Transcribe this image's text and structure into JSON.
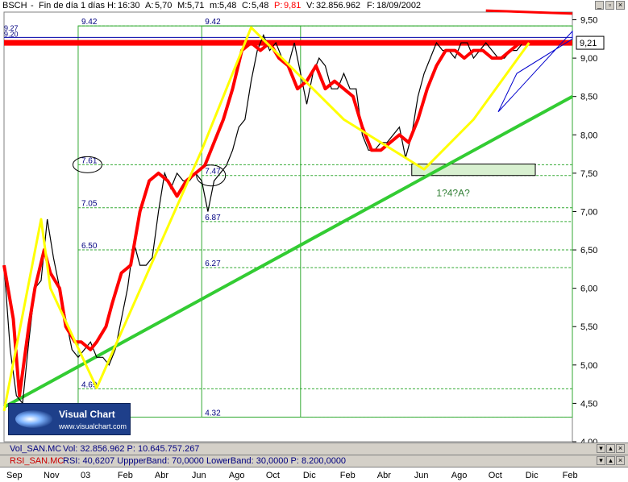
{
  "header": {
    "symbol": "BSCH",
    "period": "Fin de día 1 días",
    "items": [
      {
        "label": "H:",
        "value": "16:30"
      },
      {
        "label": "A:",
        "value": "5,70"
      },
      {
        "label": "M:",
        "value": "5,71"
      },
      {
        "label": "m:",
        "value": "5,48"
      },
      {
        "label": "C:",
        "value": "5,48"
      },
      {
        "label": "P:",
        "value": "9,81"
      },
      {
        "label": "V:",
        "value": "32.856.962"
      },
      {
        "label": "F:",
        "value": "18/09/2002"
      }
    ]
  },
  "watermark": {
    "brand": "Visual Chart",
    "url": "www.visualchart.com"
  },
  "volume_panel": {
    "label": "Vol_SAN.MC",
    "fields": "Vol: 32.856.962  P: 10.645.757.267"
  },
  "rsi_panel": {
    "label": "RSI_SAN.MC",
    "fields": "RSI: 40,6207  UppperBand: 70,0000  LowerBand: 30,0000  P: 8.200,0000"
  },
  "colors": {
    "price": "#000000",
    "moving_average": "#ff0000",
    "support_line": "#33cc33",
    "elliott_wave": "#ffff00",
    "resistance": "#ff0000",
    "fib_lines": "#33aa33",
    "axis": "#000000",
    "labels": "#000080"
  },
  "chart_data": {
    "type": "line",
    "title": "BSCH",
    "ylim": [
      4.0,
      9.6
    ],
    "y_ticks": [
      "9,50",
      "9,00",
      "8,50",
      "8,00",
      "7,50",
      "7,00",
      "6,50",
      "6,00",
      "5,50",
      "5,00",
      "4,50",
      "4,00"
    ],
    "y_tick_values": [
      9.5,
      9.0,
      8.5,
      8.0,
      7.5,
      7.0,
      6.5,
      6.0,
      5.5,
      5.0,
      4.5,
      4.0
    ],
    "x_months": [
      "Sep",
      "Nov",
      "03",
      "Feb",
      "Abr",
      "Jun",
      "Ago",
      "Oct",
      "Dic",
      "Feb",
      "Abr",
      "Jun",
      "Ago",
      "Oct",
      "Dic",
      "Feb"
    ],
    "x_month_index": [
      0,
      12,
      24,
      36,
      48,
      60,
      72,
      84,
      96,
      108,
      120,
      132,
      144,
      156,
      168,
      180
    ],
    "x_max": 184,
    "price_series": {
      "name": "Price",
      "x": [
        0,
        2,
        4,
        6,
        8,
        10,
        12,
        14,
        16,
        18,
        20,
        22,
        24,
        26,
        28,
        30,
        32,
        34,
        36,
        38,
        40,
        42,
        44,
        46,
        48,
        50,
        52,
        54,
        56,
        58,
        60,
        62,
        64,
        66,
        68,
        70,
        72,
        74,
        76,
        78,
        80,
        82,
        84,
        86,
        88,
        90,
        92,
        94,
        96,
        98,
        100,
        102,
        104,
        106,
        108,
        110,
        112,
        114,
        116,
        118,
        120,
        122,
        124,
        126,
        128,
        130,
        132,
        134,
        136,
        138,
        140,
        142,
        144,
        146,
        148,
        150,
        152,
        154,
        156,
        158,
        160,
        162,
        164,
        166,
        168,
        170
      ],
      "y": [
        6.3,
        5.2,
        4.6,
        4.5,
        5.3,
        6.0,
        6.1,
        6.9,
        6.4,
        6.0,
        5.6,
        5.2,
        5.1,
        5.2,
        5.3,
        5.1,
        5.1,
        5.0,
        5.2,
        5.6,
        6.0,
        6.6,
        6.3,
        6.3,
        6.4,
        7.0,
        7.5,
        7.3,
        7.5,
        7.4,
        7.4,
        7.5,
        7.4,
        7.0,
        7.4,
        7.5,
        7.6,
        7.8,
        8.1,
        8.2,
        8.7,
        9.1,
        9.3,
        9.1,
        9.2,
        9.0,
        8.9,
        9.2,
        8.8,
        8.4,
        8.8,
        9.0,
        8.9,
        8.6,
        8.6,
        8.8,
        8.6,
        8.6,
        8.0,
        7.8,
        7.8,
        7.9,
        7.9,
        8.0,
        8.1,
        7.7,
        8.0,
        8.5,
        8.8,
        9.0,
        9.2,
        9.1,
        9.1,
        9.0,
        9.2,
        9.2,
        9.0,
        9.1,
        9.2,
        9.1,
        9.0,
        9.0,
        9.1,
        9.1,
        9.2,
        9.2
      ]
    },
    "moving_average": {
      "name": "Moving average",
      "x": [
        0,
        3,
        5,
        8,
        10,
        13,
        15,
        18,
        20,
        23,
        25,
        28,
        30,
        33,
        35,
        38,
        41,
        44,
        47,
        50,
        53,
        56,
        59,
        62,
        65,
        68,
        71,
        74,
        77,
        80,
        83,
        86,
        89,
        92,
        95,
        98,
        101,
        104,
        107,
        110,
        113,
        116,
        119,
        122,
        125,
        128,
        131,
        134,
        137,
        140,
        143,
        146,
        149,
        152,
        155,
        158,
        161,
        164,
        167,
        170
      ],
      "y": [
        6.3,
        5.6,
        4.6,
        5.5,
        6.0,
        6.5,
        6.2,
        6.0,
        5.5,
        5.3,
        5.3,
        5.2,
        5.3,
        5.5,
        5.8,
        6.2,
        6.3,
        7.0,
        7.4,
        7.5,
        7.4,
        7.2,
        7.4,
        7.5,
        7.6,
        7.9,
        8.2,
        8.6,
        9.1,
        9.2,
        9.1,
        9.2,
        9.0,
        8.9,
        8.6,
        8.7,
        8.9,
        8.6,
        8.7,
        8.6,
        8.5,
        8.1,
        7.8,
        7.8,
        7.9,
        8.0,
        7.9,
        8.2,
        8.6,
        8.9,
        9.1,
        9.1,
        9.0,
        9.1,
        9.1,
        9.0,
        9.0,
        9.1,
        9.2,
        9.2
      ]
    },
    "elliott_wave": {
      "x": [
        0,
        12,
        15,
        30,
        64,
        80,
        110,
        136,
        152,
        170
      ],
      "y": [
        4.4,
        6.9,
        6.0,
        4.7,
        7.8,
        9.4,
        8.2,
        7.55,
        8.2,
        9.2
      ]
    },
    "support_line": {
      "x": [
        0,
        184
      ],
      "y": [
        4.45,
        8.5
      ]
    },
    "resistance_line": {
      "y": 9.2
    },
    "resistance_label": "9,21",
    "fib_levels": [
      {
        "value": "9.42",
        "y": 9.42
      },
      {
        "value": "7.61",
        "y": 7.61
      },
      {
        "value": "7.05",
        "y": 7.05
      },
      {
        "value": "6.50",
        "y": 6.5
      },
      {
        "value": "4.69",
        "y": 4.69
      },
      {
        "value": "9.42",
        "y": 9.42
      },
      {
        "value": "7.47",
        "y": 7.47
      },
      {
        "value": "6.87",
        "y": 6.87
      },
      {
        "value": "6.27",
        "y": 6.27
      },
      {
        "value": "4.32",
        "y": 4.32
      }
    ],
    "top_levels": [
      "9.27",
      "9.20"
    ],
    "annotation": "1?4?A?"
  }
}
